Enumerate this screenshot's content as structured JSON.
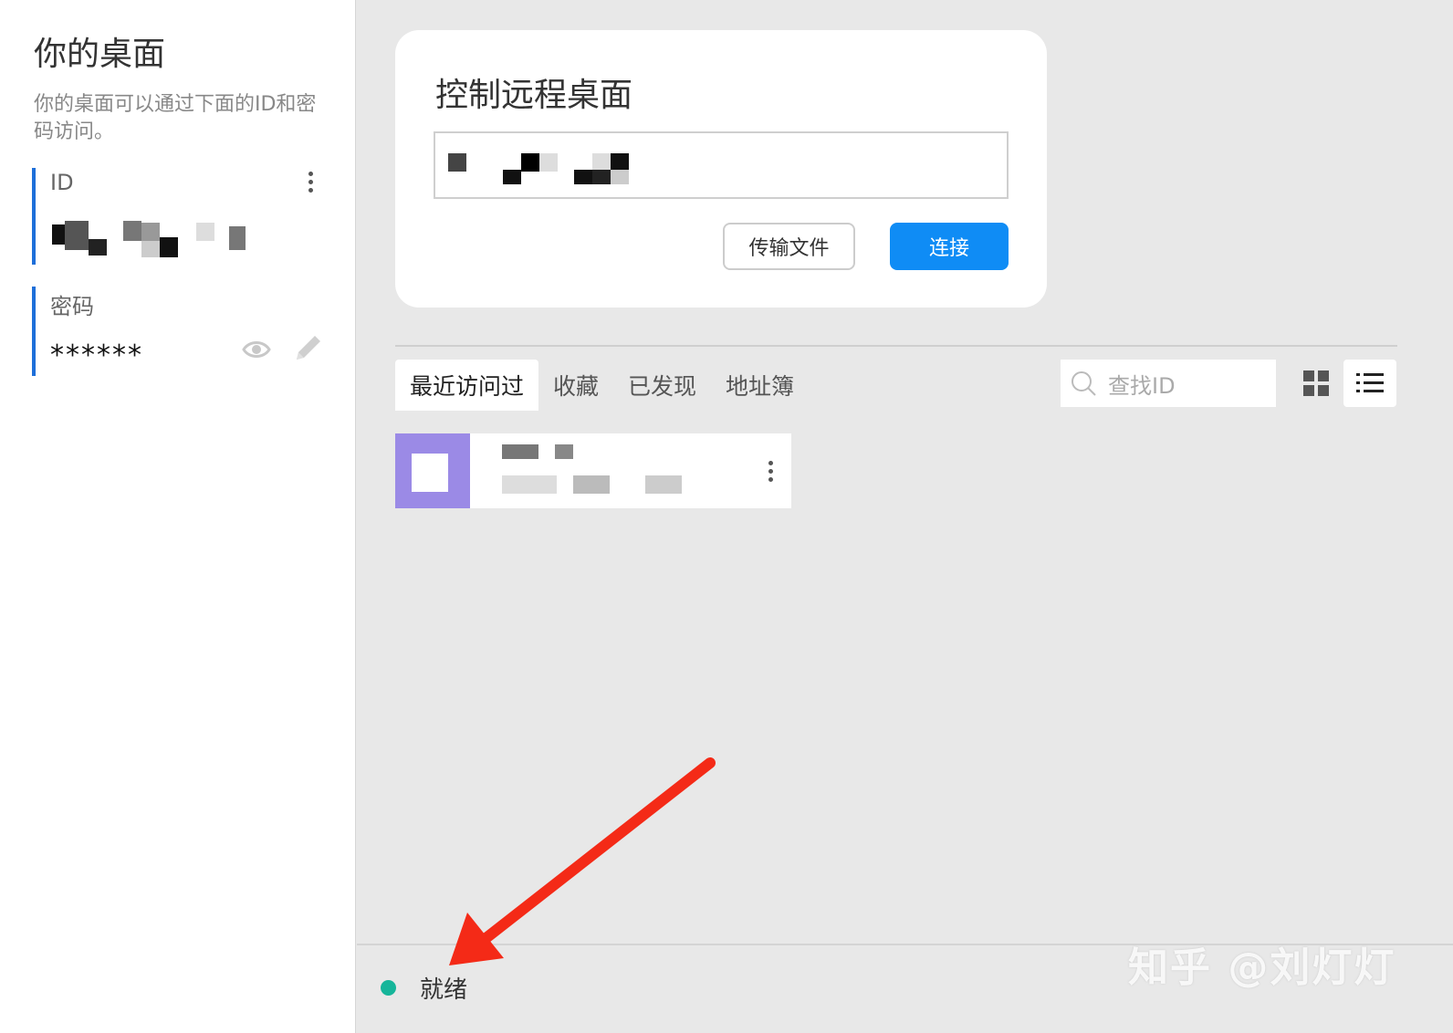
{
  "sidebar": {
    "title": "你的桌面",
    "description": "你的桌面可以通过下面的ID和密码访问。",
    "id_label": "ID",
    "password_label": "密码",
    "password_value": "******"
  },
  "connect_card": {
    "title": "控制远程桌面",
    "transfer_label": "传输文件",
    "connect_label": "连接"
  },
  "tabs": [
    "最近访问过",
    "收藏",
    "已发现",
    "地址簿"
  ],
  "search": {
    "placeholder": "查找ID"
  },
  "status": {
    "text": "就绪",
    "color": "#16b59a"
  },
  "watermark": "知乎 @刘灯灯",
  "colors": {
    "accent": "#0f8cf5",
    "sidebar_border": "#1e6fd9",
    "annotation_arrow": "#f42a17"
  },
  "icons": {
    "id_menu": "more-vertical-icon",
    "toggle_password": "eye-icon",
    "edit_password": "pencil-icon",
    "search": "search-icon",
    "grid_view": "grid-view-icon",
    "list_view": "list-view-icon",
    "peer_menu": "more-vertical-icon"
  }
}
